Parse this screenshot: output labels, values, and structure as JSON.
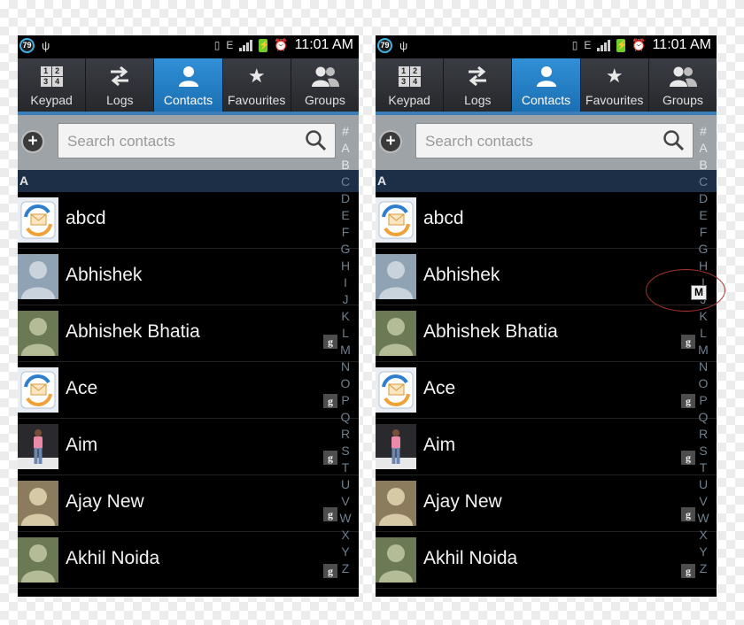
{
  "status_bar": {
    "notification_count": "79",
    "network_type": "E",
    "time": "11:01 AM"
  },
  "tabs": [
    {
      "label": "Keypad",
      "icon": "keypad-icon",
      "active": false
    },
    {
      "label": "Logs",
      "icon": "logs-icon",
      "active": false
    },
    {
      "label": "Contacts",
      "icon": "contacts-icon",
      "active": true
    },
    {
      "label": "Favourites",
      "icon": "star-icon",
      "active": false
    },
    {
      "label": "Groups",
      "icon": "groups-icon",
      "active": false
    }
  ],
  "keypad_digits": [
    "1",
    "2",
    "3",
    "4"
  ],
  "search": {
    "placeholder": "Search contacts"
  },
  "add_button_symbol": "+",
  "section_header": "A",
  "contacts": [
    {
      "name": "abcd",
      "avatar": "sync-avatar",
      "google": false
    },
    {
      "name": "Abhishek",
      "avatar": "blue-silhouette",
      "google": false
    },
    {
      "name": "Abhishek Bhatia",
      "avatar": "green-silhouette",
      "google": true
    },
    {
      "name": "Ace",
      "avatar": "sync-avatar",
      "google": true
    },
    {
      "name": "Aim",
      "avatar": "photo-person",
      "google": true
    },
    {
      "name": "Ajay New",
      "avatar": "tan-silhouette",
      "google": true
    },
    {
      "name": "Akhil Noida",
      "avatar": "green-silhouette",
      "google": true
    }
  ],
  "google_badge_label": "g",
  "alphabet_index": [
    "#",
    "A",
    "B",
    "C",
    "D",
    "E",
    "F",
    "G",
    "H",
    "I",
    "J",
    "K",
    "L",
    "M",
    "N",
    "O",
    "P",
    "Q",
    "R",
    "S",
    "T",
    "U",
    "V",
    "W",
    "X",
    "Y",
    "Z"
  ],
  "scroll_letter_popup": "M",
  "colors": {
    "accent": "#1b6fb3",
    "section_header": "#1d2f47",
    "annotation": "#a83232"
  }
}
